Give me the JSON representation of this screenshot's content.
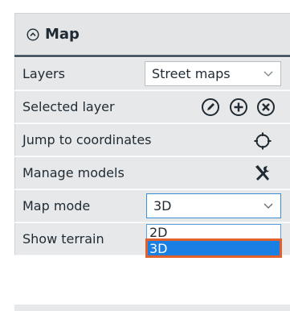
{
  "panel": {
    "title": "Map",
    "colors": {
      "header_bg": "#e3e5e6",
      "row_bg": "#e6e8e9",
      "rule": "#4c5b67",
      "highlight": "#1a7fe3",
      "callout": "#e2602c"
    }
  },
  "rows": {
    "layers": {
      "label": "Layers",
      "value": "Street maps"
    },
    "selected_layer": {
      "label": "Selected layer",
      "icons": [
        "edit-icon",
        "add-icon",
        "remove-icon"
      ]
    },
    "jump": {
      "label": "Jump to coordinates",
      "icon": "crosshair-icon"
    },
    "manage_models": {
      "label": "Manage models",
      "icon": "tools-icon"
    },
    "map_mode": {
      "label": "Map mode",
      "value": "3D",
      "options": [
        "2D",
        "3D"
      ],
      "highlighted": "3D"
    },
    "show_terrain": {
      "label": "Show terrain"
    }
  }
}
